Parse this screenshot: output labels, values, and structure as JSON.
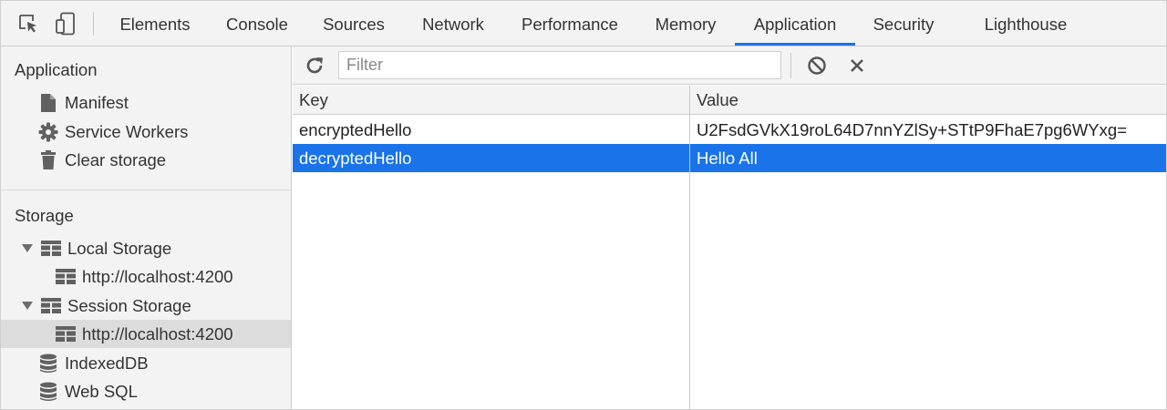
{
  "tabs": [
    {
      "label": "Elements"
    },
    {
      "label": "Console"
    },
    {
      "label": "Sources"
    },
    {
      "label": "Network"
    },
    {
      "label": "Performance"
    },
    {
      "label": "Memory"
    },
    {
      "label": "Application",
      "active": true
    },
    {
      "label": "Security"
    },
    {
      "label": "Lighthouse"
    }
  ],
  "toolbar_icons": [
    "inspect-element-icon",
    "device-toolbar-icon"
  ],
  "sidebar": {
    "application_header": "Application",
    "application_items": [
      {
        "label": "Manifest",
        "icon": "file-icon"
      },
      {
        "label": "Service Workers",
        "icon": "gear-icon"
      },
      {
        "label": "Clear storage",
        "icon": "trash-icon"
      }
    ],
    "storage_header": "Storage",
    "storage_items": [
      {
        "label": "Local Storage",
        "icon": "table-icon",
        "expanded": true
      },
      {
        "label": "http://localhost:4200",
        "icon": "table-icon"
      },
      {
        "label": "Session Storage",
        "icon": "table-icon",
        "expanded": true
      },
      {
        "label": "http://localhost:4200",
        "icon": "table-icon",
        "selected": true
      },
      {
        "label": "IndexedDB",
        "icon": "database-icon"
      },
      {
        "label": "Web SQL",
        "icon": "database-icon"
      }
    ]
  },
  "storage_toolbar": {
    "filter_placeholder": "Filter",
    "filter_value": "",
    "icons": [
      "refresh-icon",
      "clear-all-icon",
      "delete-icon"
    ]
  },
  "table": {
    "columns": [
      "Key",
      "Value"
    ],
    "rows": [
      {
        "key": "encryptedHello",
        "value": "U2FsdGVkX19roL64D7nnYZlSy+STtP9FhaE7pg6WYxg="
      },
      {
        "key": "decryptedHello",
        "value": "Hello All",
        "selected": true
      }
    ]
  },
  "colors": {
    "accent": "#1a73e8",
    "panel_bg": "#f3f3f3",
    "selected_sidebar_bg": "#dcdcdc",
    "border": "#cbcbcb"
  }
}
